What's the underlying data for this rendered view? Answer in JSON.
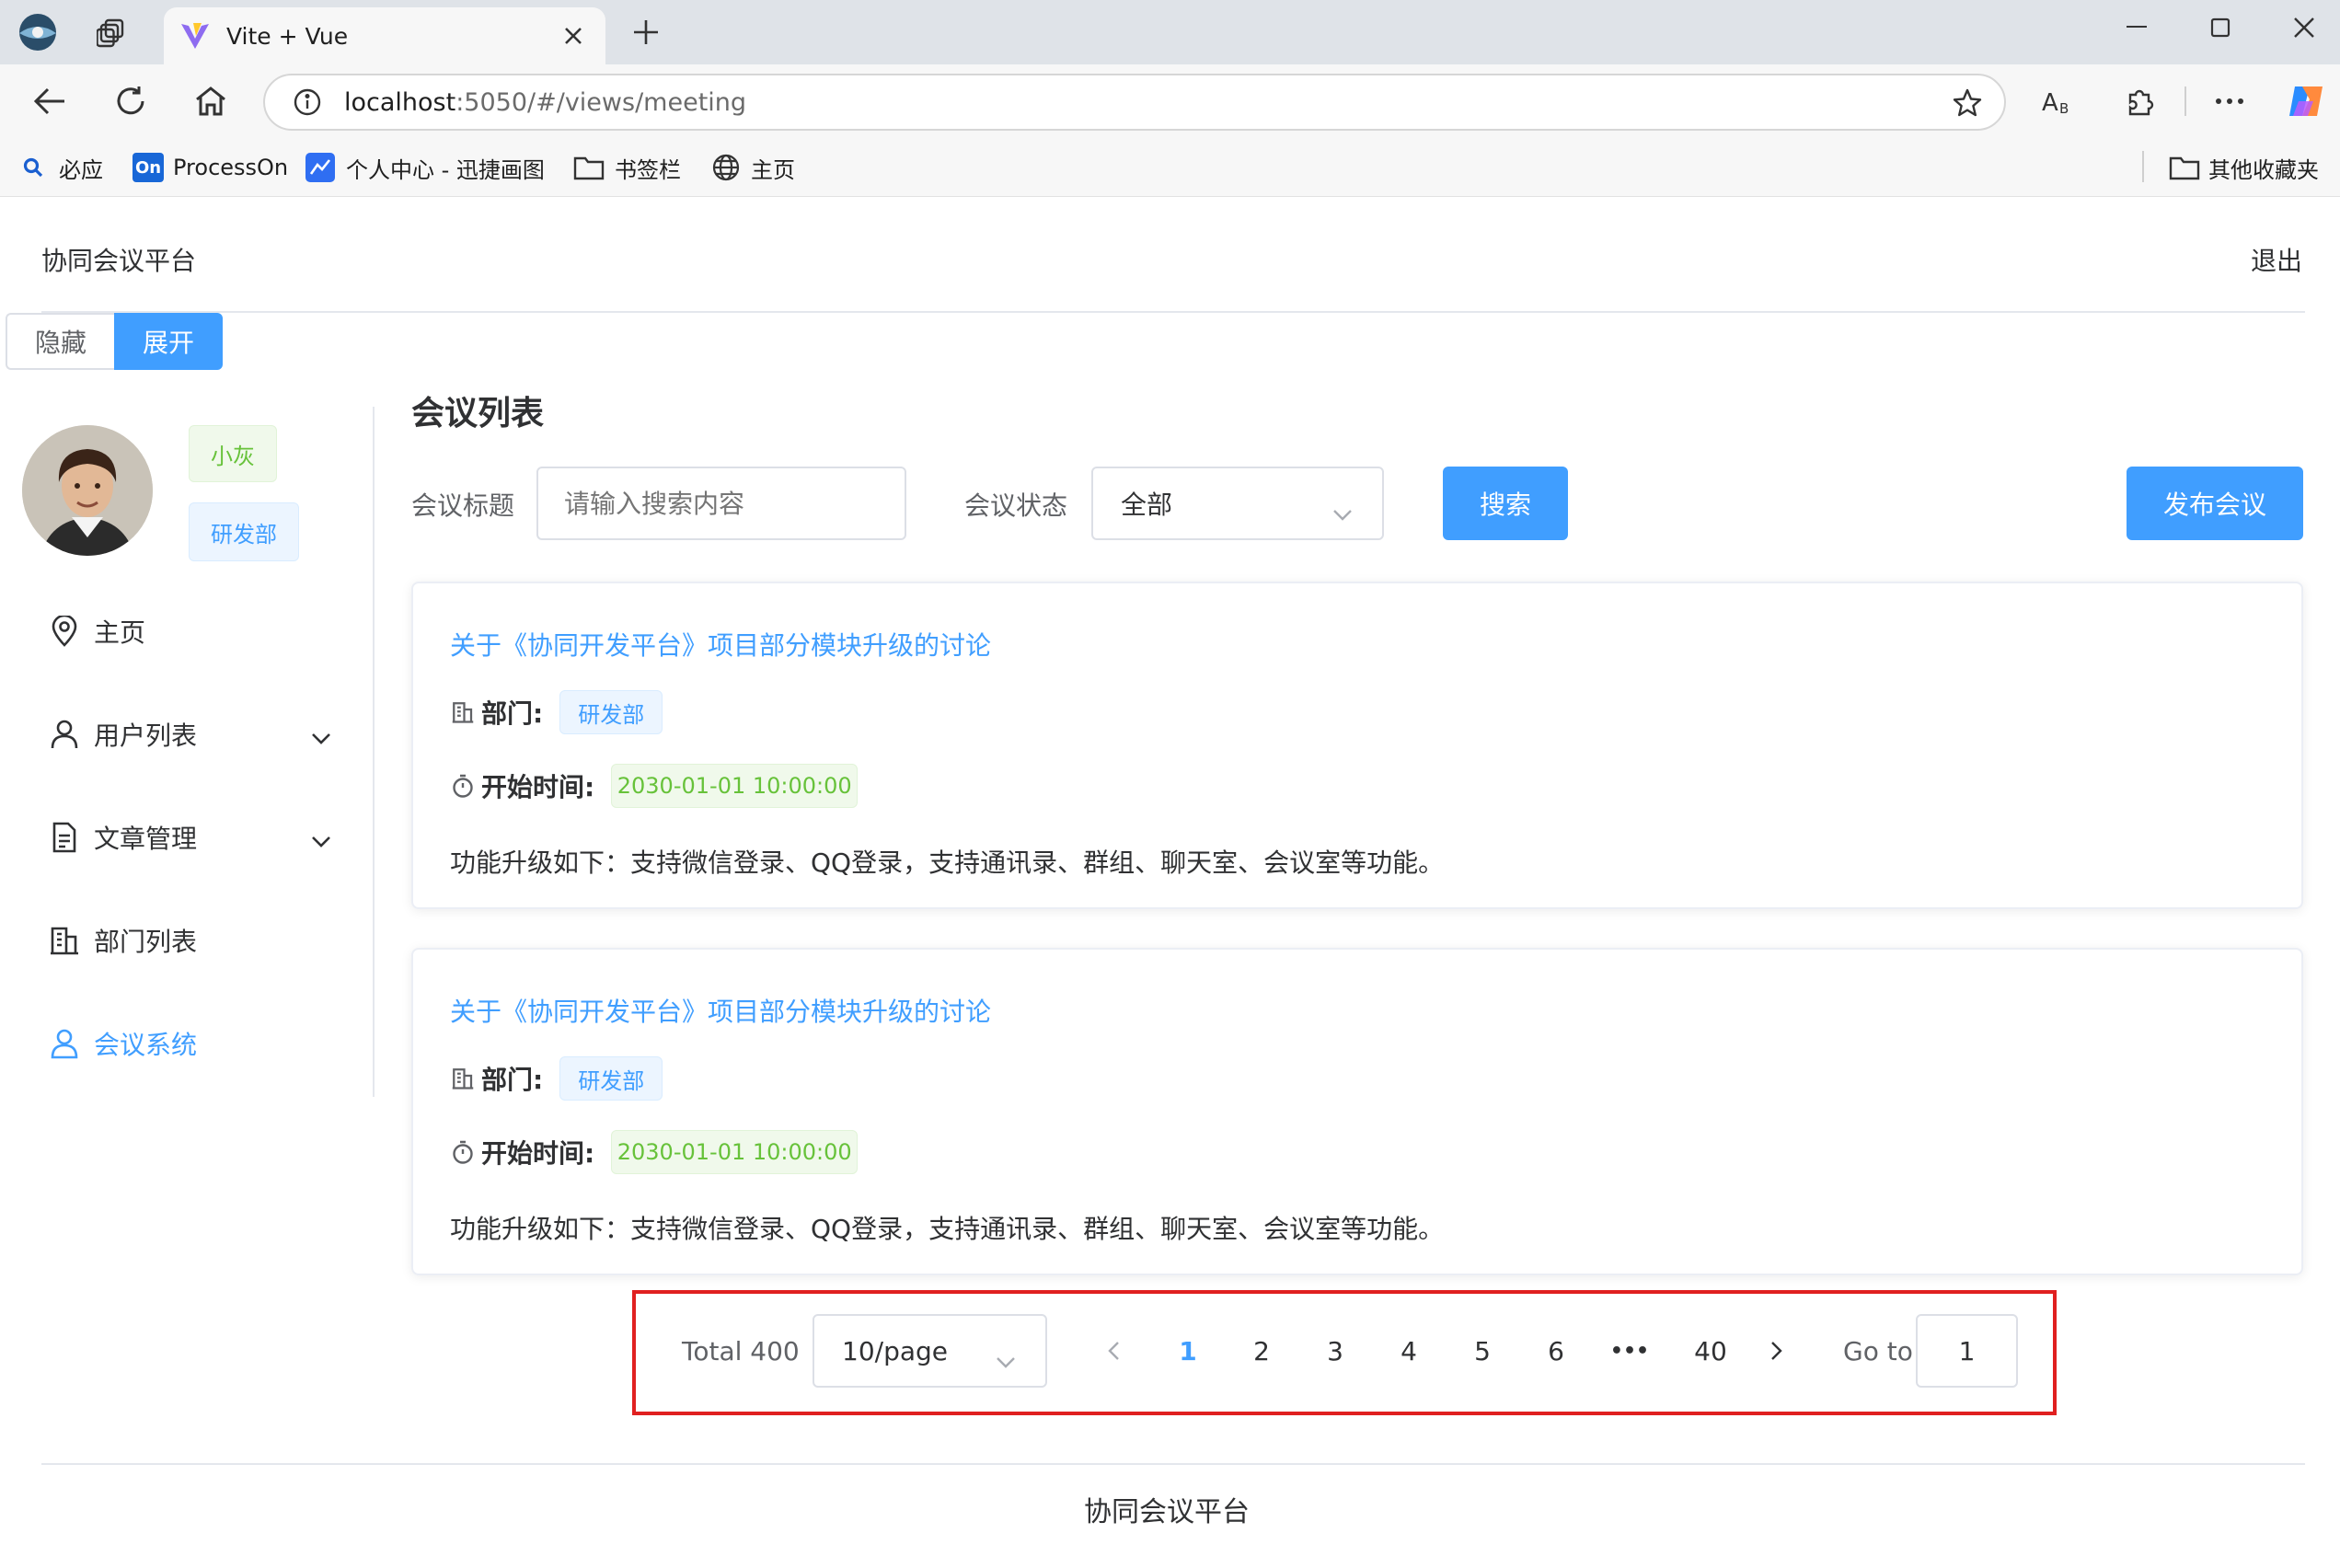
{
  "browser": {
    "tab_title": "Vite + Vue",
    "url_host": "localhost",
    "url_rest": ":5050/#/views/meeting",
    "bookmarks": [
      {
        "label": "必应",
        "icon": "bing-search-icon"
      },
      {
        "label": "ProcessOn",
        "icon": "processon-icon"
      },
      {
        "label": "个人中心 - 迅捷画图",
        "icon": "xunjie-icon"
      },
      {
        "label": "书签栏",
        "icon": "folder-icon"
      },
      {
        "label": "主页",
        "icon": "globe-icon"
      }
    ],
    "other_bookmarks": "其他收藏夹"
  },
  "app": {
    "title": "协同会议平台",
    "logout": "退出",
    "toggle": {
      "hide": "隐藏",
      "expand": "展开"
    },
    "user": {
      "name": "小灰",
      "department": "研发部"
    },
    "menu": [
      {
        "label": "主页",
        "icon": "location-icon",
        "has_children": false,
        "active": false
      },
      {
        "label": "用户列表",
        "icon": "user-icon",
        "has_children": true,
        "active": false
      },
      {
        "label": "文章管理",
        "icon": "document-icon",
        "has_children": true,
        "active": false
      },
      {
        "label": "部门列表",
        "icon": "office-building-icon",
        "has_children": false,
        "active": false
      },
      {
        "label": "会议系统",
        "icon": "user-icon",
        "has_children": false,
        "active": true
      }
    ],
    "accent_color": "#409eff",
    "footer": "协同会议平台"
  },
  "meeting": {
    "page_title": "会议列表",
    "filter": {
      "title_label": "会议标题",
      "title_placeholder": "请输入搜索内容",
      "status_label": "会议状态",
      "status_value": "全部",
      "search_button": "搜索",
      "publish_button": "发布会议"
    },
    "cards": [
      {
        "title": "关于《协同开发平台》项目部分模块升级的讨论",
        "dept_label": "部门:",
        "dept": "研发部",
        "time_label": "开始时间:",
        "time": "2030-01-01 10:00:00",
        "desc": "功能升级如下：支持微信登录、QQ登录，支持通讯录、群组、聊天室、会议室等功能。"
      },
      {
        "title": "关于《协同开发平台》项目部分模块升级的讨论",
        "dept_label": "部门:",
        "dept": "研发部",
        "time_label": "开始时间:",
        "time": "2030-01-01 10:00:00",
        "desc": "功能升级如下：支持微信登录、QQ登录，支持通讯录、群组、聊天室、会议室等功能。"
      }
    ],
    "pagination": {
      "total": "Total 400",
      "page_size": "10/page",
      "pages": [
        "1",
        "2",
        "3",
        "4",
        "5",
        "6"
      ],
      "ellipsis": "•••",
      "last": "40",
      "current": "1",
      "goto_label": "Go to",
      "goto_value": "1",
      "highlight_color": "#e02020"
    }
  }
}
